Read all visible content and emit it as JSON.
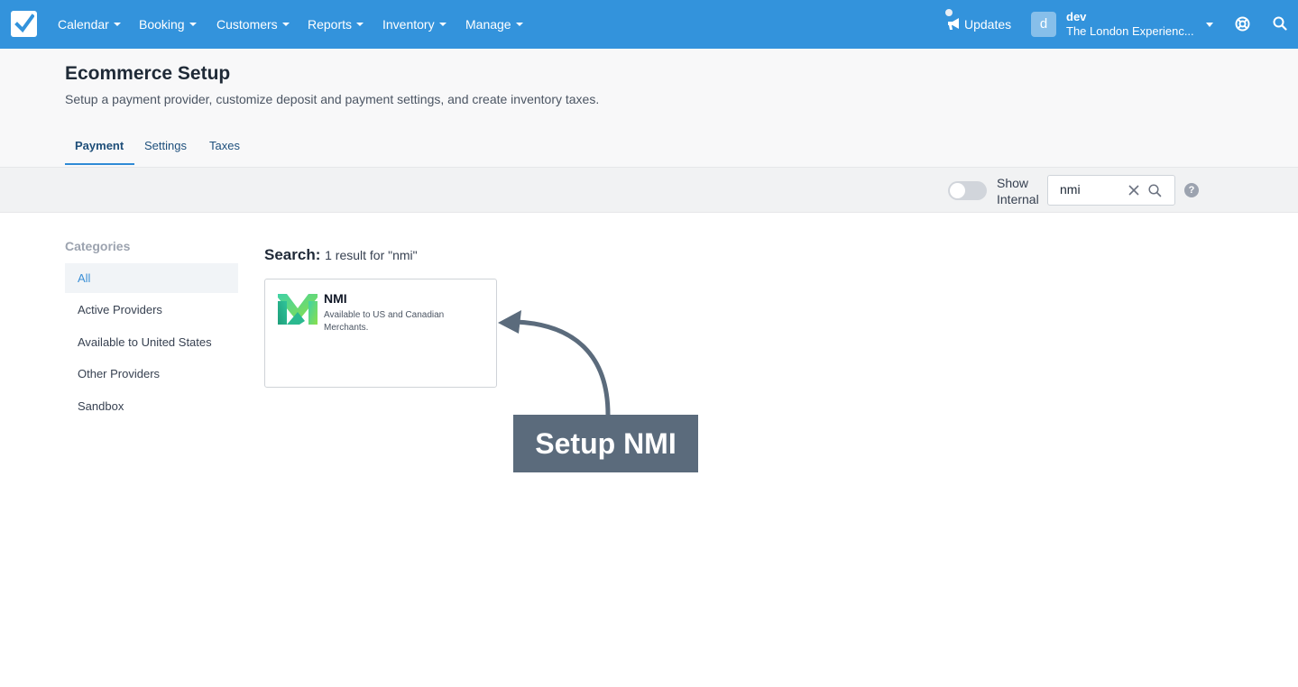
{
  "nav": {
    "items": [
      {
        "label": "Calendar"
      },
      {
        "label": "Booking"
      },
      {
        "label": "Customers"
      },
      {
        "label": "Reports"
      },
      {
        "label": "Inventory"
      },
      {
        "label": "Manage"
      }
    ],
    "updates_label": "Updates",
    "avatar_letter": "d",
    "user_name": "dev",
    "user_company": "The London Experienc..."
  },
  "header": {
    "title": "Ecommerce Setup",
    "subtitle": "Setup a payment provider, customize deposit and payment settings, and create inventory taxes.",
    "tabs": [
      {
        "label": "Payment",
        "active": true
      },
      {
        "label": "Settings",
        "active": false
      },
      {
        "label": "Taxes",
        "active": false
      }
    ]
  },
  "toolbar": {
    "show_internal_line1": "Show",
    "show_internal_line2": "Internal",
    "search_value": "nmi",
    "help_label": "?"
  },
  "sidebar": {
    "heading": "Categories",
    "items": [
      {
        "label": "All",
        "active": true
      },
      {
        "label": "Active Providers"
      },
      {
        "label": "Available to United States"
      },
      {
        "label": "Other Providers"
      },
      {
        "label": "Sandbox"
      }
    ]
  },
  "results": {
    "search_label": "Search:",
    "result_text": "1 result for \"nmi\"",
    "cards": [
      {
        "title": "NMI",
        "description": "Available to US and Canadian Merchants."
      }
    ]
  },
  "annotation": {
    "callout_text": "Setup NMI"
  },
  "colors": {
    "topbar": "#3393dc",
    "accent": "#2f8ad6",
    "callout": "#5b6b7c"
  }
}
